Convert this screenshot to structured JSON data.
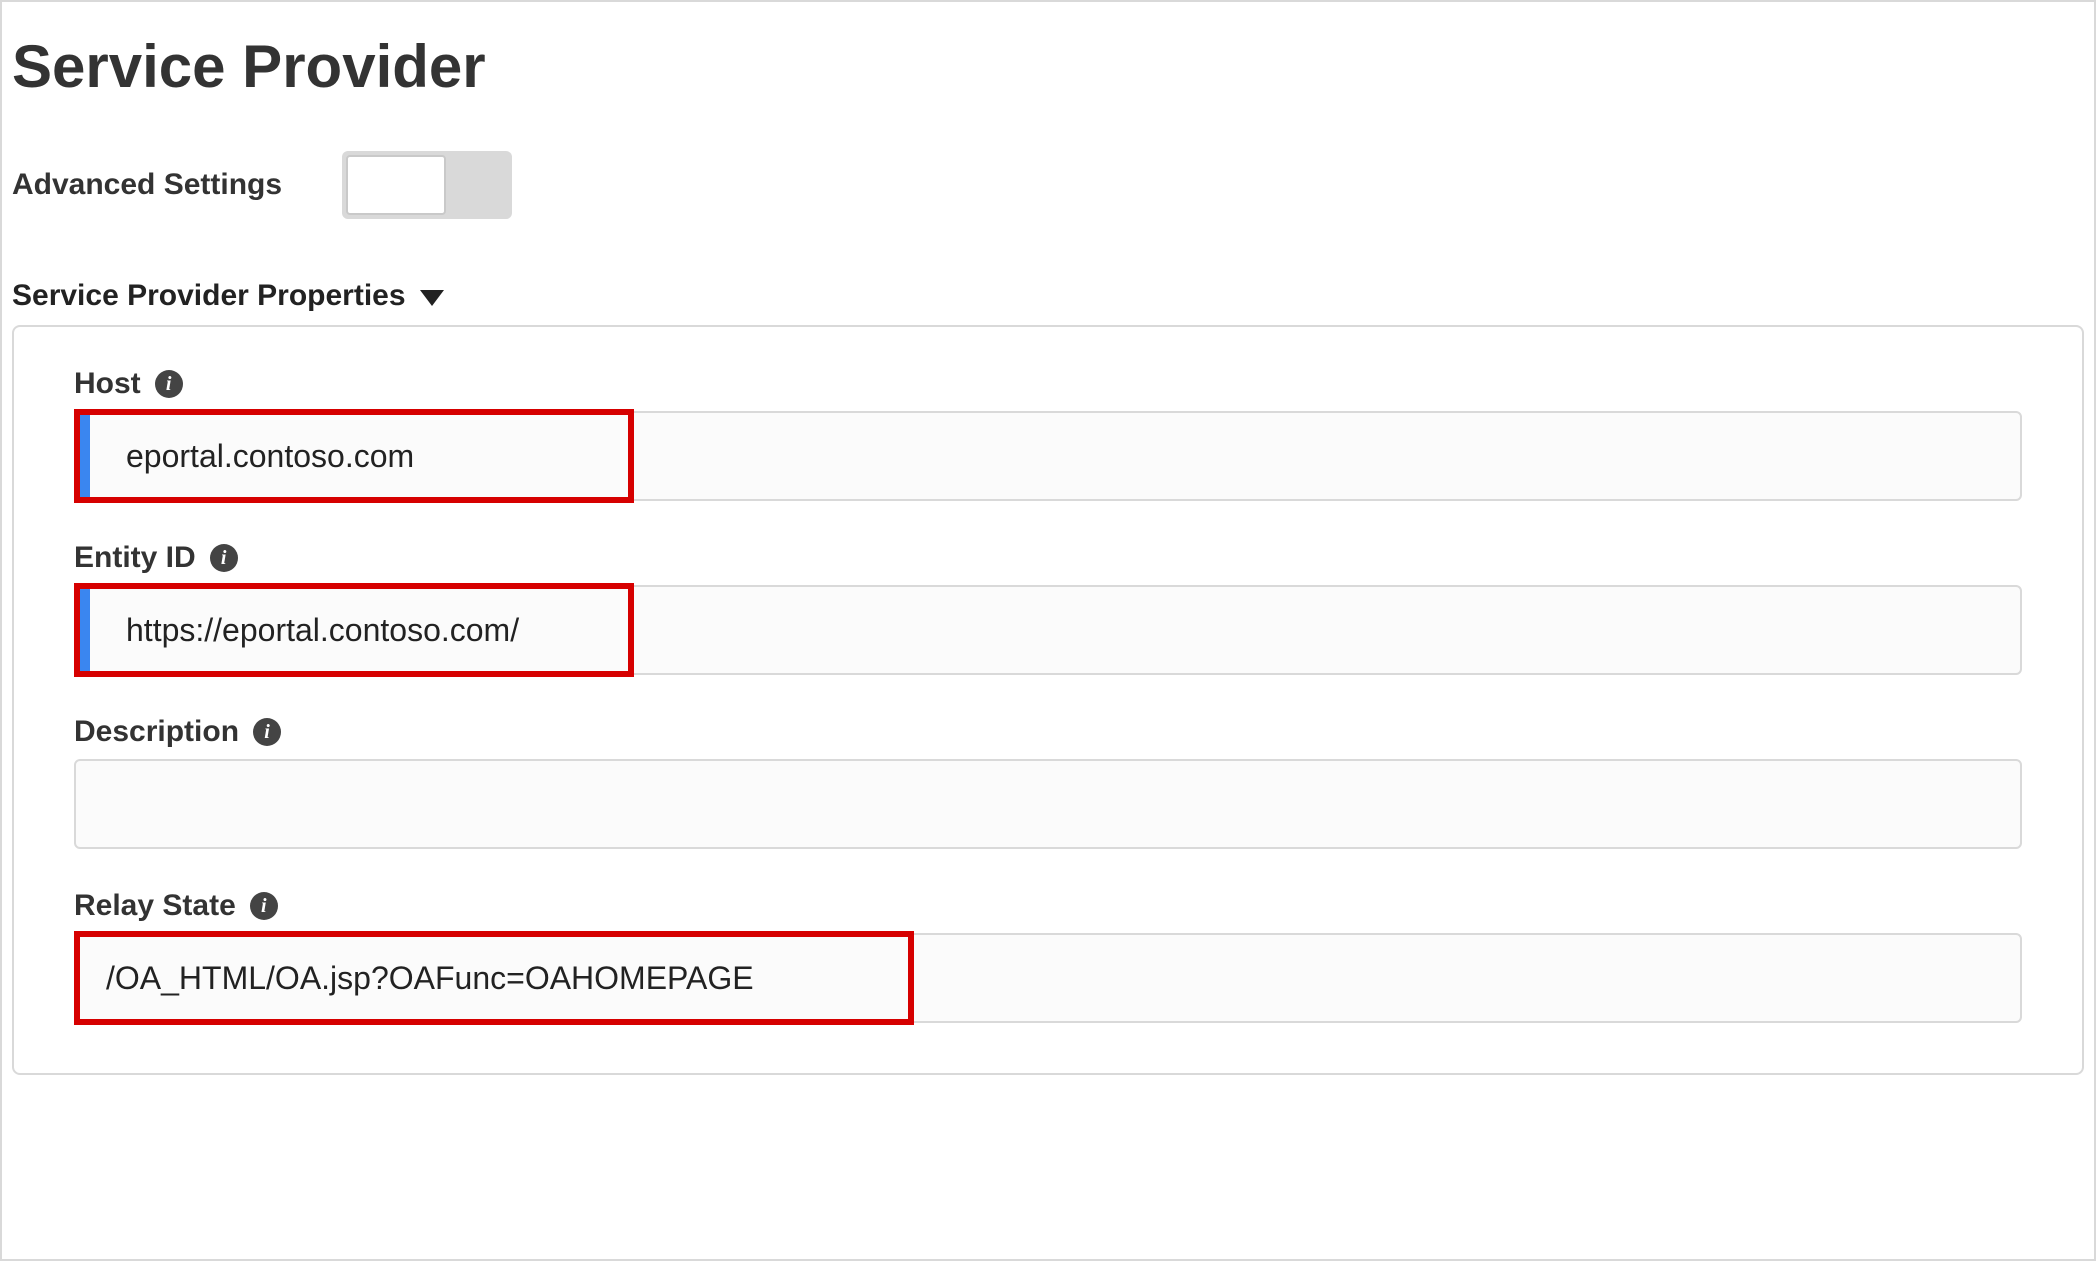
{
  "title": "Service Provider",
  "advanced_settings_label": "Advanced Settings",
  "advanced_settings_on": false,
  "section_header": "Service Provider Properties",
  "fields": {
    "host": {
      "label": "Host",
      "value": "eportal.contoso.com"
    },
    "entity_id": {
      "label": "Entity ID",
      "value": "https://eportal.contoso.com/"
    },
    "description": {
      "label": "Description",
      "value": ""
    },
    "relay_state": {
      "label": "Relay State",
      "value": "/OA_HTML/OA.jsp?OAFunc=OAHOMEPAGE"
    }
  }
}
